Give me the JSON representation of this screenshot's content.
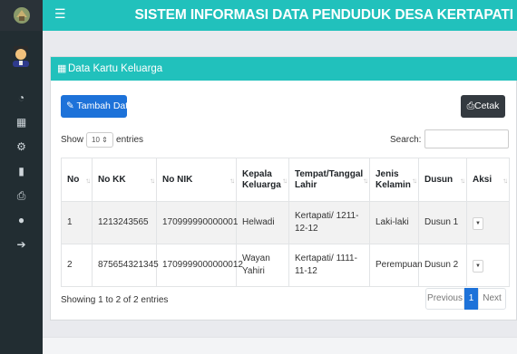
{
  "header": {
    "menu_icon": "hamburger-icon",
    "title": "SISTEM INFORMASI DATA PENDUDUK DESA KERTAPATI"
  },
  "sidebar": {
    "items": [
      {
        "icon": "dashboard-icon",
        "glyph": "◔"
      },
      {
        "icon": "table-icon",
        "glyph": "▦"
      },
      {
        "icon": "gears-icon",
        "glyph": "⚙"
      },
      {
        "icon": "file-icon",
        "glyph": "▮"
      },
      {
        "icon": "print-icon",
        "glyph": "⎙"
      },
      {
        "icon": "user-icon",
        "glyph": "●"
      },
      {
        "icon": "arrow-circle-icon",
        "glyph": "➔"
      }
    ]
  },
  "card": {
    "title": "Data Kartu Keluarga",
    "add_button": "Tambah Data",
    "print_button": "Cetak",
    "show_label": "Show",
    "entries_value": "10",
    "entries_label": "entries",
    "search_label": "Search:",
    "search_value": ""
  },
  "table": {
    "columns": [
      "No",
      "No KK",
      "No NIK",
      "Kepala Keluarga",
      "Tempat/Tanggal Lahir",
      "Jenis Kelamin",
      "Dusun",
      "Aksi"
    ],
    "rows": [
      {
        "no": "1",
        "no_kk": "1213243565",
        "no_nik": "170999990000001",
        "kepala": "Helwadi",
        "ttl": "Kertapati/ 1211-12-12",
        "jk": "Laki-laki",
        "dusun": "Dusun 1"
      },
      {
        "no": "2",
        "no_kk": "875654321345",
        "no_nik": "1709999000000012",
        "kepala": "Wayan Yahiri",
        "ttl": "Kertapati/ 1111-11-12",
        "jk": "Perempuan",
        "dusun": "Dusun 2"
      }
    ]
  },
  "pagination": {
    "info": "Showing 1 to 2 of 2 entries",
    "previous": "Previous",
    "current": "1",
    "next": "Next"
  },
  "colors": {
    "accent": "#21c1bc",
    "primary_button": "#1d72d9",
    "dark_button": "#343a40",
    "sidebar": "#222d32"
  }
}
